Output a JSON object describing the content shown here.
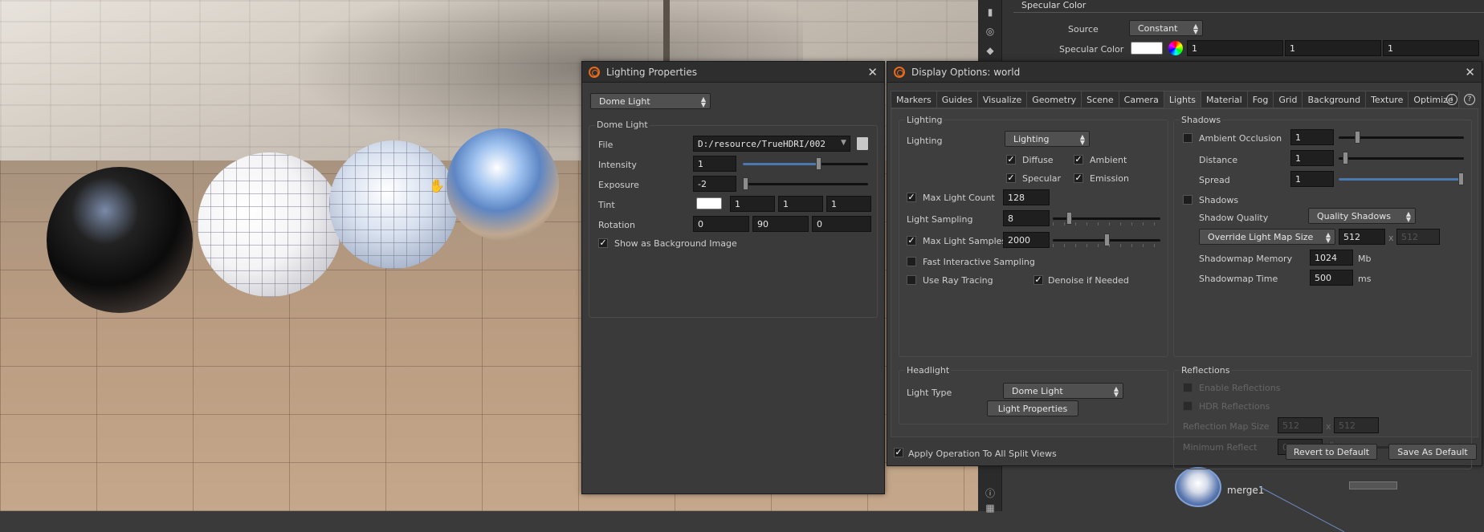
{
  "specular": {
    "header": "Specular Color",
    "source_label": "Source",
    "source_value": "Constant",
    "color_label": "Specular Color",
    "values": [
      "1",
      "1",
      "1"
    ]
  },
  "network": {
    "node_label": "merge1"
  },
  "lighting_props": {
    "title": "Lighting Properties",
    "type": "Dome Light",
    "group_title": "Dome Light",
    "file_label": "File",
    "file_value": "D:/resource/TrueHDRI/002",
    "intensity_label": "Intensity",
    "intensity_value": "1",
    "intensity_fraction": 0.6,
    "exposure_label": "Exposure",
    "exposure_value": "-2",
    "exposure_fraction": 0.0,
    "tint_label": "Tint",
    "tint_values": [
      "1",
      "1",
      "1"
    ],
    "rotation_label": "Rotation",
    "rotation_values": [
      "0",
      "90",
      "0"
    ],
    "show_bg_label": "Show as Background Image",
    "show_bg_checked": true
  },
  "display_options": {
    "title": "Display Options:",
    "title_object": "world",
    "tabs": [
      "Markers",
      "Guides",
      "Visualize",
      "Geometry",
      "Scene",
      "Camera",
      "Lights",
      "Material",
      "Fog",
      "Grid",
      "Background",
      "Texture",
      "Optimize"
    ],
    "active_tab": "Lights",
    "lighting": {
      "group_title": "Lighting",
      "label": "Lighting",
      "mode": "Lighting",
      "diffuse": "Diffuse",
      "ambient": "Ambient",
      "specular": "Specular",
      "emission": "Emission",
      "max_light_count_label": "Max Light Count",
      "max_light_count": "128",
      "light_sampling_label": "Light Sampling",
      "light_sampling": "8",
      "light_sampling_fraction": 0.15,
      "max_light_samples_label": "Max Light Samples",
      "max_light_samples": "2000",
      "max_light_samples_fraction": 0.5,
      "fast_interactive": "Fast Interactive Sampling",
      "ray_tracing": "Use Ray Tracing",
      "denoise": "Denoise if Needed"
    },
    "shadows": {
      "group_title": "Shadows",
      "ao_label": "Ambient Occlusion",
      "ao_value": "1",
      "ao_fraction": 0.15,
      "distance_label": "Distance",
      "distance_value": "1",
      "distance_fraction": 0.05,
      "spread_label": "Spread",
      "spread_value": "1",
      "spread_fraction": 1.0,
      "shadows_label": "Shadows",
      "quality_label": "Shadow Quality",
      "quality_value": "Quality Shadows",
      "override_label": "Override Light Map Size",
      "map_size": "512",
      "map_size_x": "x",
      "map_size_2": "512",
      "memory_label": "Shadowmap Memory",
      "memory_value": "1024",
      "memory_unit": "Mb",
      "time_label": "Shadowmap Time",
      "time_value": "500",
      "time_unit": "ms"
    },
    "headlight": {
      "group_title": "Headlight",
      "type_label": "Light Type",
      "type_value": "Dome Light",
      "props_button": "Light Properties"
    },
    "reflections": {
      "group_title": "Reflections",
      "enable_label": "Enable Reflections",
      "hdr_label": "HDR Reflections",
      "map_size_label": "Reflection Map Size",
      "map_size_1": "512",
      "map_size_x": "x",
      "map_size_2": "512",
      "min_reflect_label": "Minimum Reflect",
      "min_reflect_value": "0.05",
      "min_reflect_fraction": 0.0
    },
    "footer": {
      "apply_label": "Apply Operation To All Split Views",
      "revert_button": "Revert to Default",
      "save_button": "Save As Default"
    }
  },
  "colors": {
    "accent": "#4a78b0",
    "houdini_orange": "#e56a1e"
  }
}
